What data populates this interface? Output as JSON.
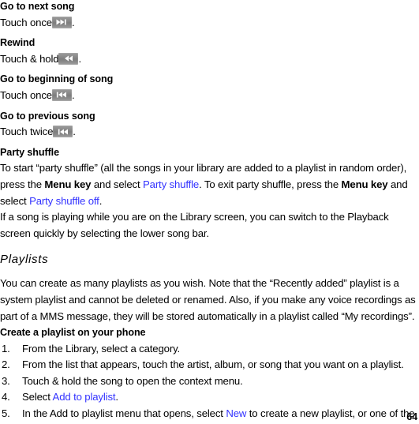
{
  "document": {
    "page_number": "64",
    "link_color": "#3333ff",
    "text_color": "#000000",
    "background_color": "#ffffff"
  },
  "controls": [
    {
      "heading": "Go to next song",
      "instruction_prefix": "Touch once",
      "instruction_suffix": ".",
      "icon": "fast-forward-icon"
    },
    {
      "heading": "Rewind",
      "instruction_prefix": "Touch & hold",
      "instruction_suffix": ".",
      "icon": "rewind-icon"
    },
    {
      "heading": "Go to beginning of song",
      "instruction_prefix": "Touch once",
      "instruction_suffix": ".",
      "icon": "skip-back-icon"
    },
    {
      "heading": "Go to previous song",
      "instruction_prefix": "Touch twice",
      "instruction_suffix": ".",
      "icon": "skip-back-icon"
    }
  ],
  "party_shuffle": {
    "heading": "Party shuffle",
    "paragraph_1": {
      "seg_1": "To start “party shuffle” (all the songs in your library are added to a playlist in random order), press the ",
      "seg_2_bold": "Menu key",
      "seg_3": " and select ",
      "seg_4_link": "Party shuffle",
      "seg_5": ". To exit party shuffle, press the ",
      "seg_6_bold": "Menu key",
      "seg_7": " and select ",
      "seg_8_link": "Party shuffle off",
      "seg_9": "."
    },
    "paragraph_2": "If a song is playing while you are on the Library screen, you can switch to the Playback screen quickly by selecting the lower song bar."
  },
  "playlists": {
    "section_title": "Playlists",
    "intro_paragraph": "You can create as many playlists as you wish. Note that the “Recently added” playlist is a system playlist and cannot be deleted or renamed. Also, if you make any voice recordings as part of a MMS message, they will be stored automatically in a playlist called “My recordings”.",
    "subheading": "Create a playlist on your phone",
    "steps": [
      {
        "number": "1.",
        "seg_1": "From the Library, select a category.",
        "seg_2_link": "",
        "seg_3": ""
      },
      {
        "number": "2.",
        "seg_1": "From the list that appears, touch the artist, album, or song that you want on a playlist.",
        "seg_2_link": "",
        "seg_3": ""
      },
      {
        "number": "3.",
        "seg_1": "Touch & hold the song to open the context menu.",
        "seg_2_link": "",
        "seg_3": ""
      },
      {
        "number": "4.",
        "seg_1": "Select ",
        "seg_2_link": "Add to playlist",
        "seg_3": "."
      },
      {
        "number": "5.",
        "seg_1": "In the Add to playlist menu that opens, select ",
        "seg_2_link": "New",
        "seg_3": " to create a new playlist, or one of the"
      }
    ]
  }
}
